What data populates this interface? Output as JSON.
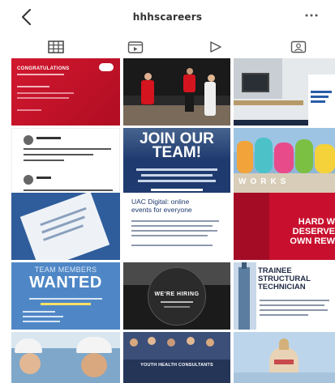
{
  "header": {
    "back_icon": "chevron-left-icon",
    "title": "hhhscareers",
    "more_icon": "ellipsis-icon"
  },
  "tabs": [
    {
      "name": "grid",
      "icon": "grid-icon",
      "active": true
    },
    {
      "name": "guides",
      "icon": "guide-icon",
      "active": false
    },
    {
      "name": "reels",
      "icon": "play-icon",
      "active": false
    },
    {
      "name": "tagged",
      "icon": "tagged-icon",
      "active": false
    }
  ],
  "posts": {
    "p1": {
      "text": "CONGRATULATIONS"
    },
    "p4_lines": [
      "JOIN OUR",
      "TEAM!"
    ],
    "p6_lines": [
      "UAC Digital: online",
      "events for everyone"
    ],
    "p7_lines": [
      "HARD W",
      "DESERVE",
      "OWN REW"
    ],
    "p8_lines": [
      "TEAM MEMBERS",
      "WANTED"
    ],
    "p9_lines": [
      "WE'RE HIRING"
    ],
    "p10_lines": [
      "TRAINEE",
      "STRUCTURAL",
      "TECHNICIAN"
    ],
    "p11": {
      "text": "WORKS"
    },
    "p12": {
      "text": "YOUTH HEALTH CONSULTANTS"
    }
  },
  "colors": {
    "accent_red": "#c8102e",
    "navy": "#1f3a6e",
    "sky": "#4f87c6",
    "icon_gray": "#555555"
  }
}
